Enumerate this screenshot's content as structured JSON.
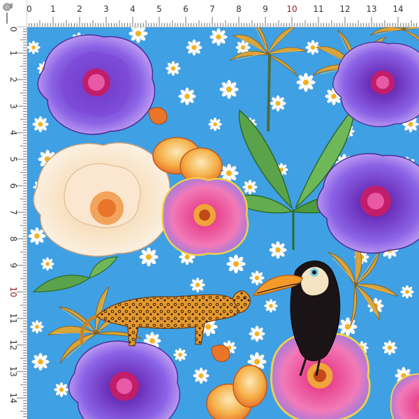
{
  "ruler": {
    "unit": "cm",
    "top_labels": [
      "0",
      "1",
      "2",
      "3",
      "4",
      "5",
      "6",
      "7",
      "8",
      "9",
      "10",
      "11",
      "12",
      "13",
      "14"
    ],
    "left_labels": [
      "0",
      "1",
      "2",
      "3",
      "4",
      "5",
      "6",
      "7",
      "8",
      "9",
      "10",
      "11",
      "12",
      "13",
      "14"
    ],
    "accent_label": "10",
    "tick_color": "#555555",
    "accent_color": "#9b1c1c"
  },
  "fabric": {
    "background_color": "#3fa0e4",
    "motifs": [
      "purple-peony-icon",
      "cream-peony-icon",
      "pink-hibiscus-icon",
      "toucan-icon",
      "leopard-icon",
      "banana-leaf-icon",
      "golden-palm-icon",
      "cashew-fruit-icon",
      "daisy-icon"
    ],
    "colors": {
      "purple": "#7a4fd6",
      "pink": "#e85aa6",
      "cream": "#f6e3c4",
      "orange": "#f39a2b",
      "gold": "#d9a53a",
      "green": "#5aa34a",
      "black": "#1b1416"
    }
  }
}
